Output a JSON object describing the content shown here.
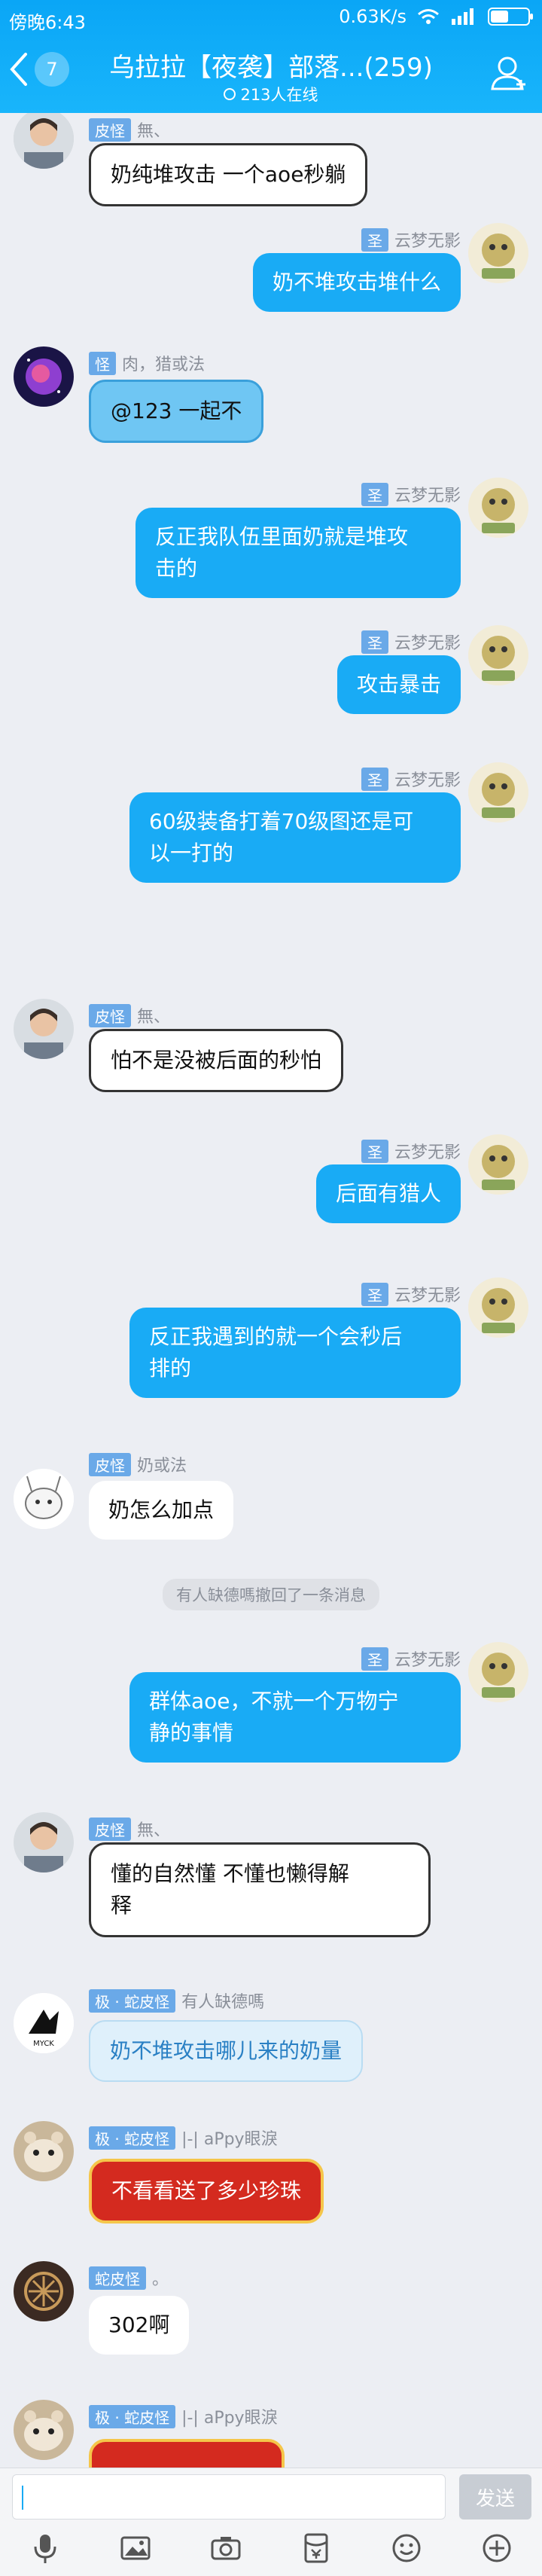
{
  "status": {
    "time": "傍晚6:43",
    "speed": "0.63K/s",
    "network": "4G"
  },
  "header": {
    "unread": "7",
    "title": "乌拉拉【夜袭】部落...(259)",
    "online": "213人在线"
  },
  "messages": [
    {
      "side": "left",
      "tag": "皮怪",
      "name": "無、",
      "text": "奶纯堆攻击 一个aoe秒躺",
      "style": "bordered",
      "avatar": "man"
    },
    {
      "side": "right",
      "tag": "圣",
      "name": "云梦无影",
      "text": "奶不堆攻击堆什么",
      "style": "normal",
      "avatar": "tiger"
    },
    {
      "side": "left",
      "tag": "怪",
      "name": "肉，猎或法",
      "text": "@123 一起不",
      "style": "cloud",
      "avatar": "galaxy"
    },
    {
      "side": "right",
      "tag": "圣",
      "name": "云梦无影",
      "text1": "反正我队伍里面奶就是堆攻",
      "text2": "击的",
      "style": "normal",
      "avatar": "tiger"
    },
    {
      "side": "right",
      "tag": "圣",
      "name": "云梦无影",
      "text": "攻击暴击",
      "style": "normal",
      "avatar": "tiger"
    },
    {
      "side": "right",
      "tag": "圣",
      "name": "云梦无影",
      "text1": "60级装备打着70级图还是可",
      "text2": "以一打的",
      "style": "normal",
      "avatar": "tiger"
    },
    {
      "side": "left",
      "tag": "皮怪",
      "name": "無、",
      "text": "怕不是没被后面的秒怕",
      "style": "bordered",
      "avatar": "man"
    },
    {
      "side": "right",
      "tag": "圣",
      "name": "云梦无影",
      "text": "后面有猎人",
      "style": "normal",
      "avatar": "tiger"
    },
    {
      "side": "right",
      "tag": "圣",
      "name": "云梦无影",
      "text1": "反正我遇到的就一个会秒后",
      "text2": "排的",
      "style": "normal",
      "avatar": "tiger"
    },
    {
      "side": "left",
      "tag": "皮怪",
      "name": "奶或法",
      "text": "奶怎么加点",
      "style": "plain",
      "avatar": "bunny"
    },
    {
      "side": "right",
      "tag": "圣",
      "name": "云梦无影",
      "text1": "群体aoe，不就一个万物宁",
      "text2": "静的事情",
      "style": "normal",
      "avatar": "tiger"
    },
    {
      "side": "left",
      "tag": "皮怪",
      "name": "無、",
      "text1": "懂的自然懂  不懂也懒得解",
      "text2": "释",
      "style": "bordered",
      "avatar": "man"
    },
    {
      "side": "left",
      "tag": "极 · 蛇皮怪",
      "name": "有人缺德嗎",
      "text": "奶不堆攻击哪儿来的奶量",
      "style": "soft",
      "avatar": "logo"
    },
    {
      "side": "left",
      "tag": "极 · 蛇皮怪",
      "name": "|-| aPpy眼淚",
      "text": "不看看送了多少珍珠",
      "style": "red",
      "avatar": "hamster"
    },
    {
      "side": "left",
      "tag": "蛇皮怪",
      "name": "。",
      "text": "302啊",
      "style": "plain",
      "avatar": "orb"
    },
    {
      "side": "left",
      "tag": "极 · 蛇皮怪",
      "name": "|-| aPpy眼淚",
      "text": "",
      "style": "red",
      "avatar": "hamster"
    }
  ],
  "recall_notice": "有人缺德嗎撤回了一条消息",
  "composer": {
    "placeholder": "",
    "send_label": "发送"
  },
  "toolbar": [
    "mic-icon",
    "image-icon",
    "camera-icon",
    "red-packet-icon",
    "emoji-icon",
    "plus-icon"
  ],
  "colors": {
    "header": "#12aef8",
    "out_bubble": "#19abf5",
    "background": "#eceef3"
  }
}
